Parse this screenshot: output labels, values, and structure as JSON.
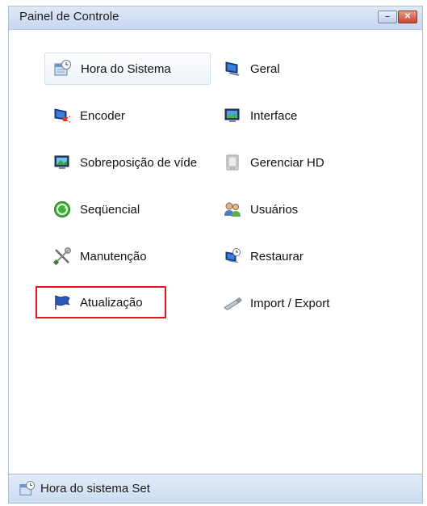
{
  "window": {
    "title": "Painel de Controle",
    "minimize_glyph": "–",
    "close_glyph": "✕"
  },
  "items": [
    {
      "label": "Hora do Sistema",
      "icon": "calendar-clock-icon",
      "highlighted": true
    },
    {
      "label": "Geral",
      "icon": "monitor-icon"
    },
    {
      "label": "Encoder",
      "icon": "monitor-arrow-icon"
    },
    {
      "label": "Interface",
      "icon": "monitor-landscape-icon"
    },
    {
      "label": "Sobreposição de víde",
      "icon": "monitor-overlay-icon"
    },
    {
      "label": "Gerenciar HD",
      "icon": "hard-disk-icon"
    },
    {
      "label": "Seqüencial",
      "icon": "green-cycle-icon"
    },
    {
      "label": "Usuários",
      "icon": "users-icon"
    },
    {
      "label": "Manutenção",
      "icon": "tools-icon"
    },
    {
      "label": "Restaurar",
      "icon": "restore-icon"
    },
    {
      "label": "Atualização",
      "icon": "flag-icon",
      "selected": true
    },
    {
      "label": "Import / Export",
      "icon": "usb-drive-icon"
    }
  ],
  "status": {
    "text": "Hora do sistema Set",
    "icon": "calendar-clock-icon"
  },
  "colors": {
    "selection_border": "#e8161b",
    "titlebar": "#c6d7ee",
    "statusbar": "#cbdcf0"
  }
}
